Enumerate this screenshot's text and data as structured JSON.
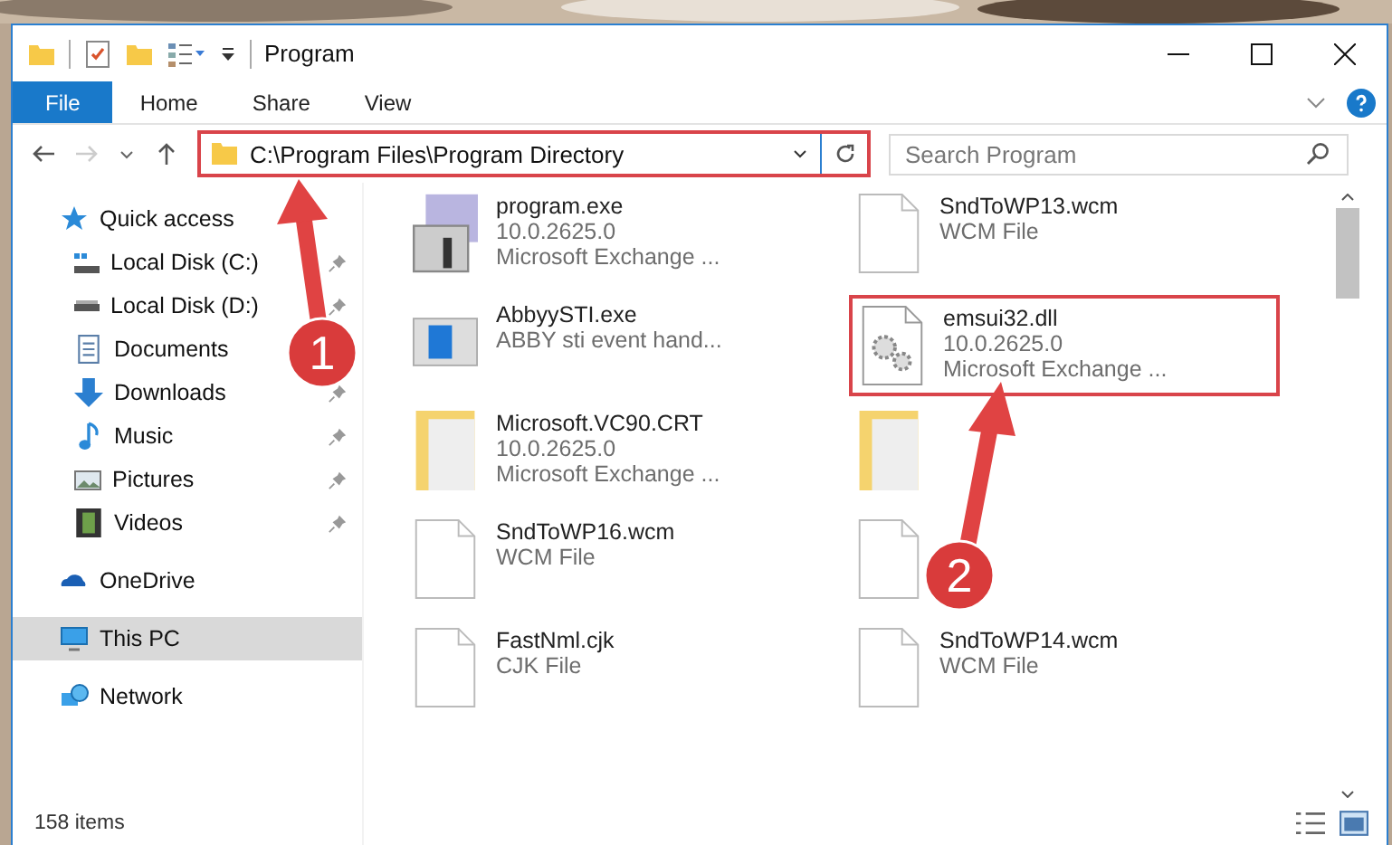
{
  "window": {
    "title": "Program"
  },
  "ribbon_tabs": [
    {
      "label": "File",
      "selected": true
    },
    {
      "label": "Home",
      "selected": false
    },
    {
      "label": "Share",
      "selected": false
    },
    {
      "label": "View",
      "selected": false
    }
  ],
  "address_bar": {
    "path": "C:\\Program Files\\Program Directory",
    "highlighted": true
  },
  "search": {
    "placeholder": "Search Program"
  },
  "sidebar": {
    "items": [
      {
        "label": "Quick access",
        "selected": false,
        "children": [
          {
            "label": "Local Disk (C:)",
            "pinned": true,
            "selected": false
          },
          {
            "label": "Local Disk (D:)",
            "pinned": true,
            "selected": false
          },
          {
            "label": "Documents",
            "selected": false
          },
          {
            "label": "Downloads",
            "pinned": true,
            "selected": false
          },
          {
            "label": "Music",
            "pinned": true,
            "selected": false
          },
          {
            "label": "Pictures",
            "pinned": true,
            "selected": false
          },
          {
            "label": "Videos",
            "pinned": true,
            "selected": false
          }
        ]
      },
      {
        "label": "OneDrive",
        "selected": false
      },
      {
        "label": "This PC",
        "selected": true
      },
      {
        "label": "Network",
        "selected": false
      }
    ]
  },
  "files": [
    {
      "name": "program.exe",
      "details": [
        "10.0.2625.0",
        "Microsoft Exchange ..."
      ],
      "highlighted": false
    },
    {
      "name": "SndToWP13.wcm",
      "details": [
        "WCM File"
      ],
      "highlighted": false
    },
    {
      "name": "AbbyySTI.exe",
      "details": [
        "ABBY sti event hand..."
      ],
      "highlighted": false
    },
    {
      "name": "emsui32.dll",
      "details": [
        "10.0.2625.0",
        "Microsoft Exchange ..."
      ],
      "highlighted": true
    },
    {
      "name": "Microsoft.VC90.CRT",
      "details": [
        "10.0.2625.0",
        "Microsoft Exchange ..."
      ],
      "highlighted": false
    },
    {
      "highlighted": false
    },
    {
      "name": "SndToWP16.wcm",
      "details": [
        "WCM File"
      ],
      "highlighted": false
    },
    {
      "highlighted": false
    },
    {
      "name": "FastNml.cjk",
      "details": [
        "CJK File"
      ],
      "highlighted": false
    },
    {
      "name": "SndToWP14.wcm",
      "details": [
        "WCM File"
      ],
      "highlighted": false
    }
  ],
  "status_bar": {
    "item_count": "158 items"
  },
  "annotations": [
    {
      "number": "1"
    },
    {
      "number": "2"
    }
  ]
}
